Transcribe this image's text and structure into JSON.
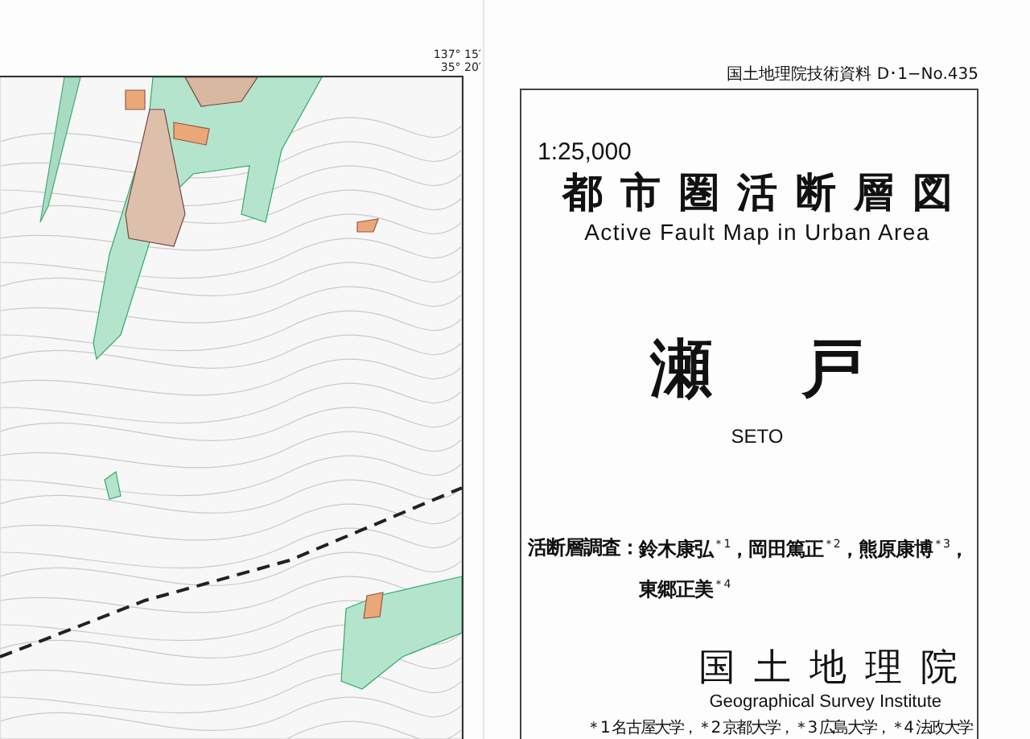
{
  "header": {
    "series_label": "国土地理院技術資料 D･1−No.435"
  },
  "map": {
    "longitude_label": "137° 15′",
    "latitude_label": "35° 20′"
  },
  "title_panel": {
    "scale": "1:25,000",
    "title_ja": "都市圏活断層図",
    "title_en": "Active Fault Map in Urban Area",
    "sheet_name_ja": "瀬戸",
    "sheet_name_en": "SETO",
    "survey_label": "活断層調査：",
    "investigators": "鈴木康弘$^{＊1}$，岡田篤正$^{＊2}$，熊原康博$^{＊3}$，東郷正美$^{＊4}$",
    "publisher_ja": "国土地理院",
    "publisher_en": "Geographical Survey Institute",
    "affiliations": "＊1 名古屋大学，＊2 京都大学，＊3 広島大学，＊4 法政大学"
  }
}
